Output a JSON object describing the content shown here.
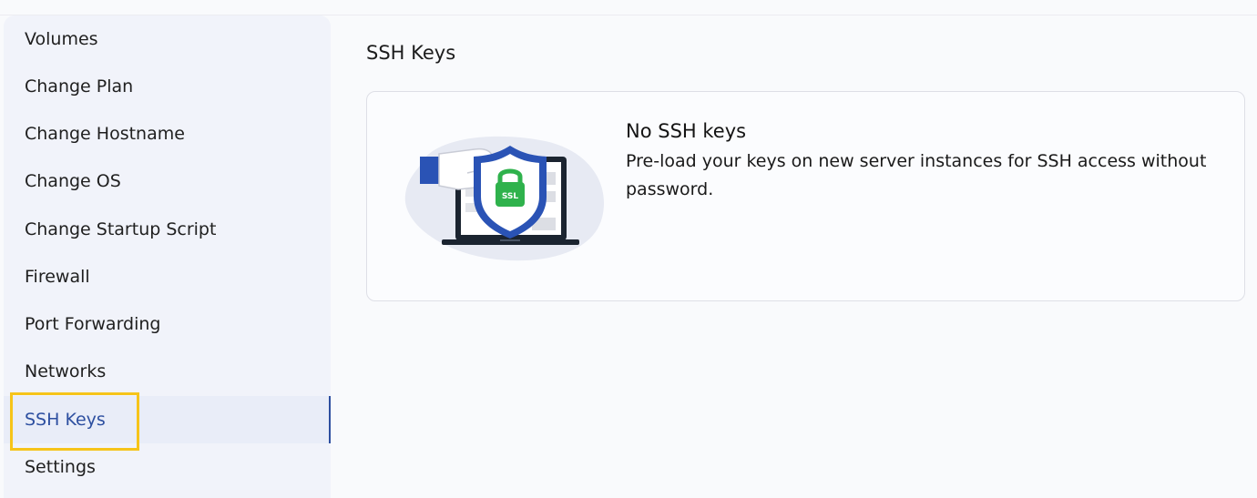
{
  "sidebar": {
    "items": [
      {
        "label": "Volumes"
      },
      {
        "label": "Change Plan"
      },
      {
        "label": "Change Hostname"
      },
      {
        "label": "Change OS"
      },
      {
        "label": "Change Startup Script"
      },
      {
        "label": "Firewall"
      },
      {
        "label": "Port Forwarding"
      },
      {
        "label": "Networks"
      },
      {
        "label": "SSH Keys",
        "active": true
      },
      {
        "label": "Settings"
      }
    ]
  },
  "main": {
    "title": "SSH Keys",
    "empty_state": {
      "title": "No SSH keys",
      "description": "Pre-load your keys on new server instances for SSH access without password.",
      "illustration": {
        "icon": "laptop-shield-lock-icon",
        "badge_text": "SSL"
      }
    }
  },
  "colors": {
    "accent": "#2d4fa0",
    "highlight": "#f6c419",
    "lock_green": "#2fb24c",
    "shield_blue": "#2a53b5"
  }
}
